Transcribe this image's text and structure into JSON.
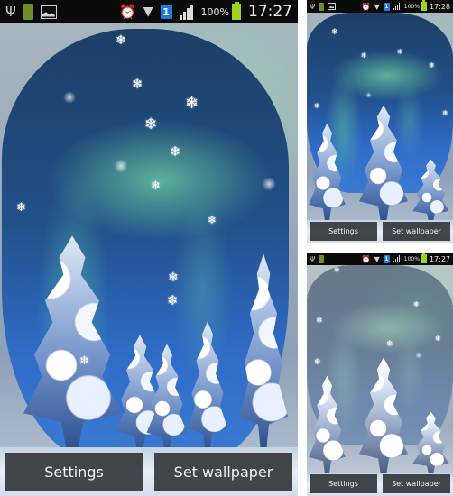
{
  "screenshots": [
    {
      "id": "main",
      "status_bar": {
        "left_icons": [
          "usb-icon",
          "battery-saver-icon",
          "gallery-icon"
        ],
        "right_icons": [
          "alarm-icon",
          "wifi-icon",
          "notification-badge-icon",
          "signal-icon"
        ],
        "notification_badge": "1",
        "battery_percent": "100%",
        "time": "17:27"
      },
      "buttons": {
        "settings": "Settings",
        "set_wallpaper": "Set wallpaper"
      }
    },
    {
      "id": "preview-top",
      "status_bar": {
        "notification_badge": "1",
        "battery_percent": "100%",
        "time": "17:28"
      },
      "buttons": {
        "settings": "Settings",
        "set_wallpaper": "Set wallpaper"
      }
    },
    {
      "id": "preview-bottom",
      "status_bar": {
        "notification_badge": "1",
        "battery_percent": "100%",
        "time": "17:27"
      },
      "buttons": {
        "settings": "Settings",
        "set_wallpaper": "Set wallpaper"
      }
    }
  ],
  "glyphs": {
    "usb": "Ψ",
    "alarm": "⏰",
    "wifi": "▼",
    "snowflake": "❄"
  },
  "colors": {
    "statusbar_bg": "#0b0b0b",
    "battery_green": "#9bd21e",
    "badge_blue": "#1f7de0",
    "button_bg": "#32373c",
    "sky_dark_blue": "#1c3f66",
    "aurora_green": "#6ed2a0"
  }
}
